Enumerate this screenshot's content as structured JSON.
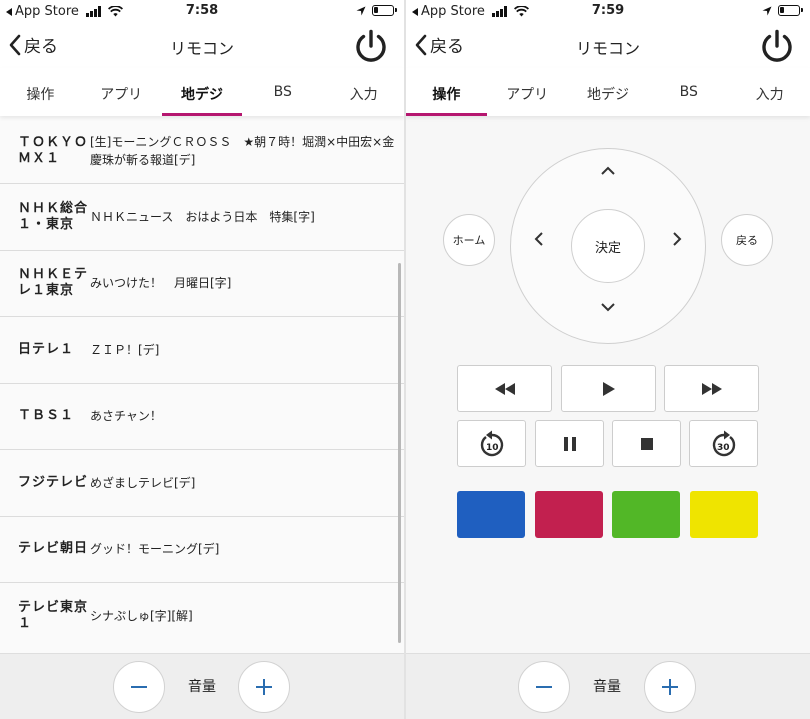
{
  "status_left": {
    "app_store": "App Store",
    "time": "7:58"
  },
  "status_right": {
    "app_store": "App Store",
    "time": "7:59"
  },
  "nav": {
    "back_label": "戻る",
    "title": "リモコン"
  },
  "tabs": [
    {
      "label": "操作"
    },
    {
      "label": "アプリ"
    },
    {
      "label": "地デジ"
    },
    {
      "label": "BS"
    },
    {
      "label": "入力"
    }
  ],
  "channels": [
    {
      "name": "ＴＯＫＹＯ ＭＸ１",
      "program": "[生]モーニングＣＲＯＳＳ　★朝７時！堀潤×中田宏×金慶珠が斬る報道[デ]"
    },
    {
      "name": "ＮＨＫ総合１・東京",
      "program": "ＮＨＫニュース　おはよう日本　特集[字]"
    },
    {
      "name": "ＮＨＫＥテレ１東京",
      "program": "みいつけた！　月曜日[字]"
    },
    {
      "name": "日テレ１",
      "program": "ＺＩＰ！[デ]"
    },
    {
      "name": "ＴＢＳ１",
      "program": "あさチャン！"
    },
    {
      "name": "フジテレビ",
      "program": "めざましテレビ[デ]"
    },
    {
      "name": "テレビ朝日",
      "program": "グッド！モーニング[デ]"
    },
    {
      "name": "テレビ東京１",
      "program": "シナぷしゅ[字][解]"
    }
  ],
  "remote": {
    "ok_label": "決定",
    "home_label": "ホーム",
    "back_label": "戻る",
    "skip_back_seconds": "10",
    "skip_forward_seconds": "30",
    "color_buttons": [
      {
        "name": "blue",
        "color": "#1f5fc0"
      },
      {
        "name": "red",
        "color": "#c2204f"
      },
      {
        "name": "green",
        "color": "#52b727"
      },
      {
        "name": "yellow",
        "color": "#efe400"
      }
    ]
  },
  "volume": {
    "label": "音量"
  },
  "colors": {
    "accent": "#b5166f",
    "power": "#222222"
  }
}
